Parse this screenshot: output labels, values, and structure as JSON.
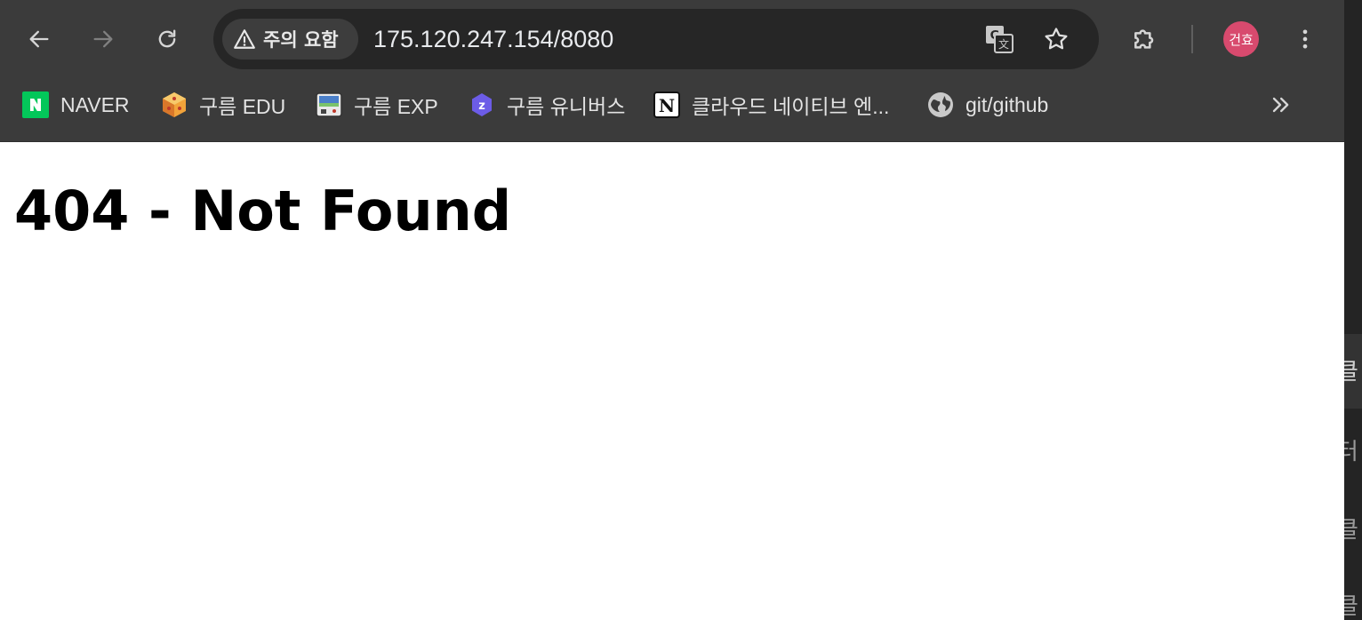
{
  "nav": {
    "back_icon": "arrow-left-icon",
    "forward_icon": "arrow-right-icon",
    "reload_icon": "reload-icon"
  },
  "omnibox": {
    "security_label": "주의 요함",
    "security_icon": "warning-triangle-icon",
    "url": "175.120.247.154/8080",
    "translate_icon": "translate-icon",
    "bookmark_icon": "star-icon"
  },
  "toolbar": {
    "extensions_icon": "puzzle-icon",
    "profile_label": "건효",
    "profile_color": "#d84a6e",
    "menu_icon": "vertical-dots-icon"
  },
  "bookmarks": {
    "items": [
      {
        "label": "NAVER",
        "icon": "naver-icon"
      },
      {
        "label": "구름 EDU",
        "icon": "goorm-edu-icon"
      },
      {
        "label": "구름 EXP",
        "icon": "goorm-exp-icon"
      },
      {
        "label": "구름 유니버스",
        "icon": "goorm-universe-icon"
      },
      {
        "label": "클라우드 네이티브 엔...",
        "icon": "notion-icon"
      },
      {
        "label": "git/github",
        "icon": "globe-icon"
      }
    ],
    "overflow_icon": "double-chevron-right-icon"
  },
  "page": {
    "heading": "404 - Not Found"
  },
  "side_window": {
    "fragments": [
      "클",
      "터",
      "클",
      "클"
    ]
  },
  "colors": {
    "toolbar_bg": "#3b3b3b",
    "omnibox_bg": "#262626",
    "page_bg": "#ffffff",
    "text_light": "#e8eaed"
  }
}
